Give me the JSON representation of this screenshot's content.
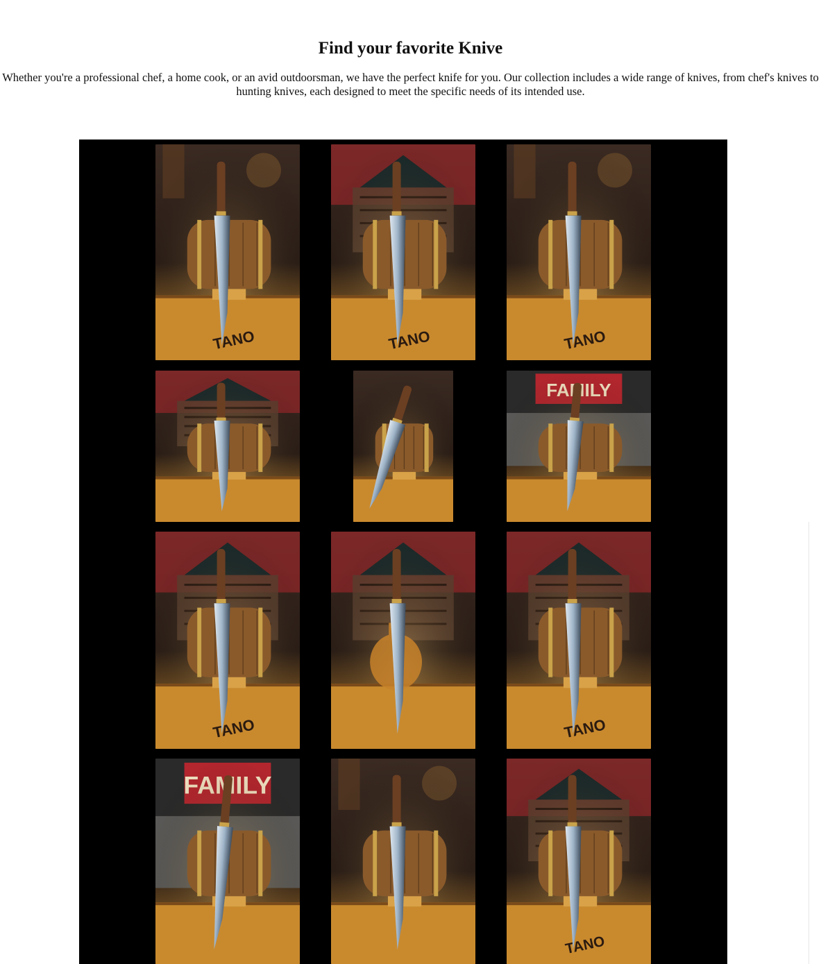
{
  "header": {
    "title": "Find your favorite Knive",
    "intro": "Whether you're a professional chef, a home cook, or an avid outdoorsman, we have the perfect knife for you. Our collection includes a wide range of knives, from chef's knives to hunting knives, each designed to meet the specific needs of its intended use."
  },
  "gallery": {
    "background": "#000000",
    "photos": [
      {
        "name": "knife-barrel-photo-1",
        "sign": "TANO",
        "variant": "closeup"
      },
      {
        "name": "knife-barrel-photo-2",
        "sign": "TANO",
        "variant": "grill"
      },
      {
        "name": "knife-barrel-photo-3",
        "sign": "TANO",
        "variant": "closeup"
      },
      {
        "name": "knife-barrel-photo-4",
        "sign": "",
        "variant": "grill"
      },
      {
        "name": "knife-barrel-photo-5",
        "sign": "",
        "variant": "angled"
      },
      {
        "name": "knife-barrel-photo-6",
        "sign": "FAMILY",
        "variant": "family"
      },
      {
        "name": "knife-barrel-photo-7",
        "sign": "TANO",
        "variant": "grill"
      },
      {
        "name": "knife-bottle-photo-8",
        "sign": "",
        "variant": "bottle"
      },
      {
        "name": "knife-barrel-photo-9",
        "sign": "TANO",
        "variant": "grill"
      },
      {
        "name": "knife-barrel-photo-10",
        "sign": "FAMILY",
        "variant": "family"
      },
      {
        "name": "knife-barrel-photo-11",
        "sign": "",
        "variant": "closeup"
      },
      {
        "name": "knife-barrel-photo-12",
        "sign": "TANO",
        "variant": "grill"
      }
    ]
  },
  "colors": {
    "wood": "#c98a2e",
    "barrel": "#8a5a2b",
    "brass": "#c9a24a",
    "blade": "#9fb4c8",
    "backdrop": "#3a2a22",
    "red_wall": "#b3262e"
  }
}
